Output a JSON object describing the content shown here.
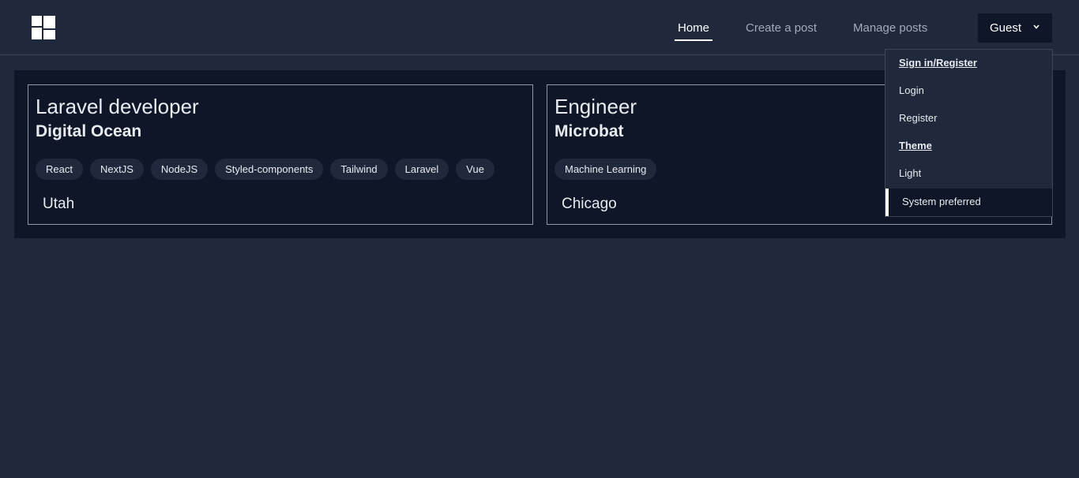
{
  "nav": {
    "home": "Home",
    "create_post": "Create a post",
    "manage_posts": "Manage posts",
    "user_label": "Guest"
  },
  "dropdown": {
    "auth_header": "Sign in/Register",
    "login": "Login",
    "register": "Register",
    "theme_header": "Theme",
    "light": "Light",
    "system_preferred": "System preferred"
  },
  "posts": [
    {
      "title": "Laravel developer",
      "company": "Digital Ocean",
      "tags": [
        "React",
        "NextJS",
        "NodeJS",
        "Styled-components",
        "Tailwind",
        "Laravel",
        "Vue"
      ],
      "location": "Utah"
    },
    {
      "title": "Engineer",
      "company": "Microbat",
      "tags": [
        "Machine Learning"
      ],
      "location": "Chicago"
    }
  ],
  "icons": {
    "logo": "grid-logo-icon",
    "user_chevron": "chevron-down-icon"
  },
  "colors": {
    "page_bg": "#1f293b",
    "panel_bg": "#0e1628",
    "text": "#e8ebf0",
    "muted_text": "#a1aab8"
  }
}
